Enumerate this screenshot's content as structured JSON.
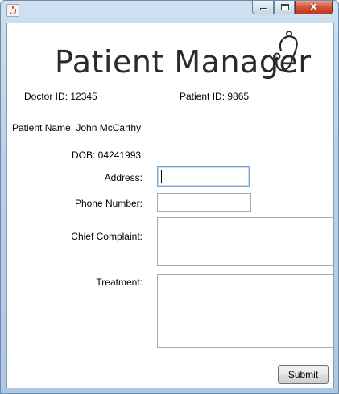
{
  "window": {
    "close_glyph": "x",
    "icon": "java-cup-icon"
  },
  "logo": {
    "text": "Patient Manager",
    "icon": "stethoscope-icon"
  },
  "info": {
    "doctor_id": "Doctor ID: 12345",
    "patient_id": "Patient ID: 9865",
    "patient_name": "Patient Name: John McCarthy",
    "dob": "DOB: 04241993"
  },
  "form": {
    "address_label": "Address:",
    "address_value": "",
    "phone_label": "Phone Number:",
    "phone_value": "",
    "complaint_label": "Chief Complaint:",
    "complaint_value": "",
    "treatment_label": "Treatment:",
    "treatment_value": "",
    "submit_label": "Submit"
  }
}
